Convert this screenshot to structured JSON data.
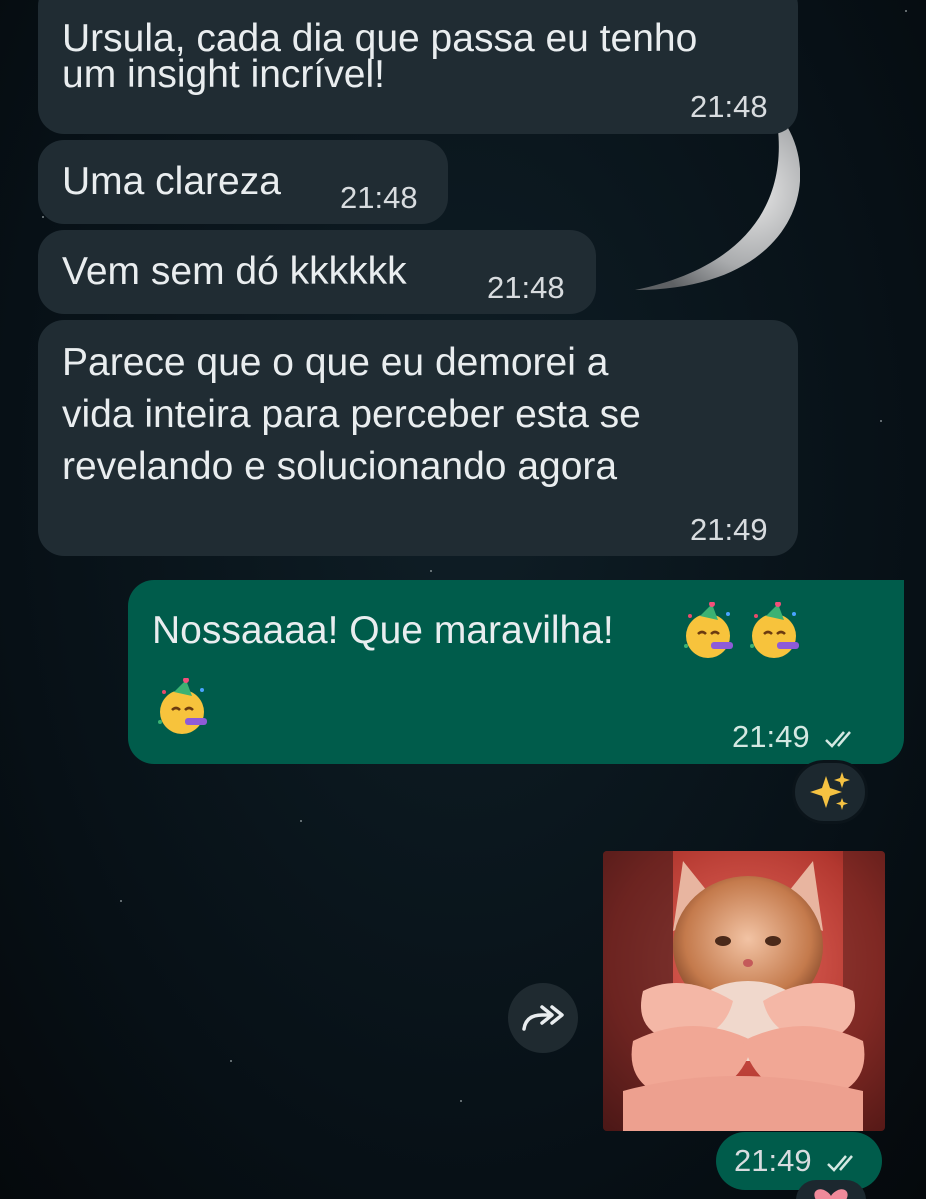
{
  "chat": {
    "messages": [
      {
        "direction": "incoming",
        "lines": [
          "Ursula, cada dia que passa eu tenho",
          "um insight incrível!"
        ],
        "time": "21:48"
      },
      {
        "direction": "incoming",
        "lines": [
          "Uma clareza"
        ],
        "time": "21:48"
      },
      {
        "direction": "incoming",
        "lines": [
          "Vem sem dó kkkkkk"
        ],
        "time": "21:48"
      },
      {
        "direction": "incoming",
        "lines": [
          "Parece que o que eu demorei a",
          "vida inteira para perceber esta se",
          "revelando e solucionando agora"
        ],
        "time": "21:49"
      },
      {
        "direction": "outgoing",
        "lines": [
          "Nossaaaa! Que maravilha!"
        ],
        "emojis": [
          "partying-face",
          "partying-face",
          "partying-face"
        ],
        "time": "21:49",
        "status": "read-double-tick"
      },
      {
        "direction": "outgoing",
        "type": "media",
        "media_description_icon": "video-thumbnail",
        "time": "21:49",
        "status": "read-double-tick"
      }
    ],
    "reaction": {
      "emoji": "sparkles-icon"
    },
    "colors": {
      "incoming_bubble": "#202c33",
      "outgoing_bubble": "#005c4b",
      "text": "#e9edef",
      "read_tick": "#d4e8e2"
    }
  }
}
